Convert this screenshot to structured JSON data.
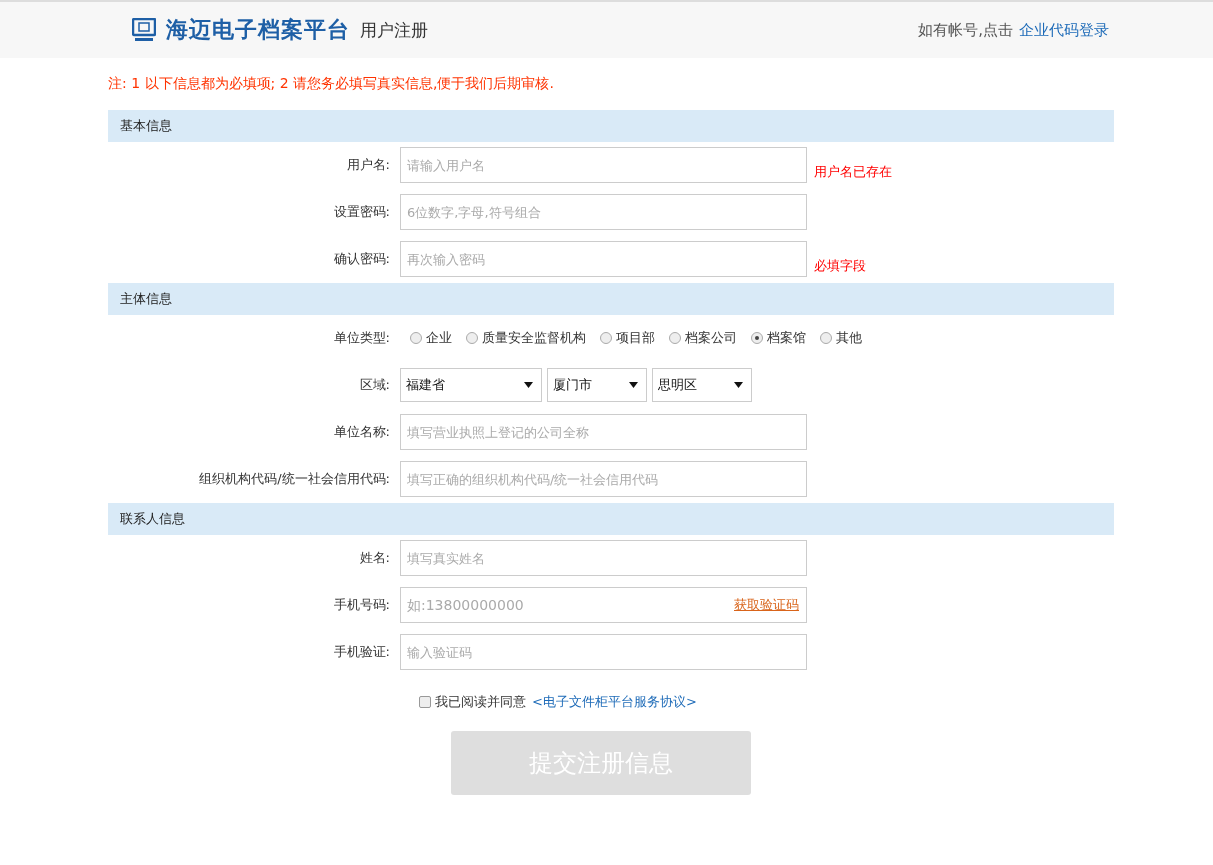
{
  "header": {
    "logo_text": "海迈电子档案平台",
    "page_title": "用户注册",
    "login_prompt": "如有帐号,点击",
    "login_link": "企业代码登录"
  },
  "notice": "注: 1 以下信息都为必填项; 2 请您务必填写真实信息,便于我们后期审核.",
  "sections": [
    {
      "title": "基本信息",
      "fields": [
        {
          "kind": "text",
          "label": "用户名:",
          "placeholder": "请输入用户名",
          "error": "用户名已存在"
        },
        {
          "kind": "text",
          "label": "设置密码:",
          "placeholder": "6位数字,字母,符号组合"
        },
        {
          "kind": "text",
          "label": "确认密码:",
          "placeholder": "再次输入密码",
          "error": "必填字段"
        }
      ]
    },
    {
      "title": "主体信息",
      "fields": [
        {
          "kind": "radio",
          "label": "单位类型:",
          "options": [
            {
              "label": "企业",
              "selected": false
            },
            {
              "label": "质量安全监督机构",
              "selected": false
            },
            {
              "label": "项目部",
              "selected": false
            },
            {
              "label": "档案公司",
              "selected": false
            },
            {
              "label": "档案馆",
              "selected": true
            },
            {
              "label": "其他",
              "selected": false
            }
          ]
        },
        {
          "kind": "select",
          "label": "区域:",
          "selects": [
            "福建省",
            "厦门市",
            "思明区"
          ]
        },
        {
          "kind": "text",
          "label": "单位名称:",
          "placeholder": "填写营业执照上登记的公司全称"
        },
        {
          "kind": "text",
          "label": "组织机构代码/统一社会信用代码:",
          "placeholder": "填写正确的组织机构代码/统一社会信用代码"
        }
      ]
    },
    {
      "title": "联系人信息",
      "fields": [
        {
          "kind": "text",
          "label": "姓名:",
          "placeholder": "填写真实姓名"
        },
        {
          "kind": "sms",
          "label": "手机号码:",
          "placeholder": "如:13800000000",
          "action": "获取验证码"
        },
        {
          "kind": "text",
          "label": "手机验证:",
          "placeholder": "输入验证码"
        }
      ]
    }
  ],
  "agreement": {
    "checked": false,
    "text": "我已阅读并同意",
    "link": "<电子文件柜平台服务协议>"
  },
  "submit": {
    "label": "提交注册信息",
    "disabled": true
  }
}
